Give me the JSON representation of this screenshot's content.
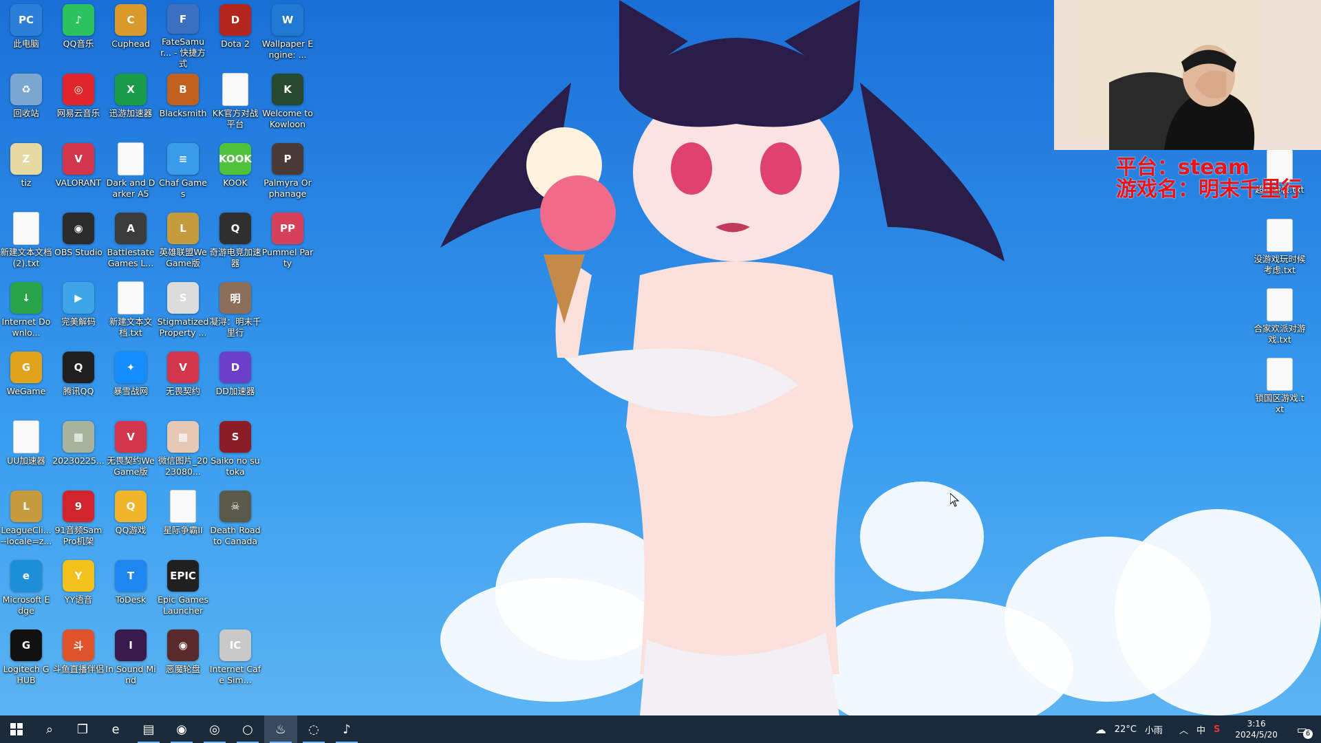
{
  "desktop": {
    "icons": [
      {
        "label": "此电脑",
        "glyph": "PC",
        "bg": "#2b7fd8",
        "doc": false
      },
      {
        "label": "QQ音乐",
        "glyph": "♪",
        "bg": "#2ac35f",
        "doc": false
      },
      {
        "label": "Cuphead",
        "glyph": "C",
        "bg": "#d89a2a",
        "doc": false
      },
      {
        "label": "FateSamur... - 快捷方式",
        "glyph": "F",
        "bg": "#3b6fbf",
        "doc": false
      },
      {
        "label": "Dota 2",
        "glyph": "D",
        "bg": "#b3261e",
        "doc": false
      },
      {
        "label": "Wallpaper Engine: ...",
        "glyph": "W",
        "bg": "#1f78d1",
        "doc": false
      },
      {
        "label": "回收站",
        "glyph": "♻",
        "bg": "#7aa6cf",
        "doc": false
      },
      {
        "label": "网易云音乐",
        "glyph": "◎",
        "bg": "#e0262b",
        "doc": false
      },
      {
        "label": "迅游加速器",
        "glyph": "X",
        "bg": "#1a9b4a",
        "doc": false
      },
      {
        "label": "Blacksmith",
        "glyph": "B",
        "bg": "#c2611f",
        "doc": false
      },
      {
        "label": "KK官方对战平台",
        "glyph": "",
        "bg": "#ffffff",
        "doc": true
      },
      {
        "label": "Welcome to Kowloon",
        "glyph": "K",
        "bg": "#274a2f",
        "doc": false
      },
      {
        "label": "tiz",
        "glyph": "Z",
        "bg": "#e7d9a2",
        "doc": false
      },
      {
        "label": "VALORANT",
        "glyph": "V",
        "bg": "#d1364d",
        "doc": false
      },
      {
        "label": "Dark and Darker A5",
        "glyph": "",
        "bg": "#ffffff",
        "doc": true
      },
      {
        "label": "Chaf Games",
        "glyph": "≡",
        "bg": "#3a9be8",
        "doc": false
      },
      {
        "label": "KOOK",
        "glyph": "KOOK",
        "bg": "#4ec23a",
        "doc": false
      },
      {
        "label": "Palmyra Orphanage",
        "glyph": "P",
        "bg": "#4a3a36",
        "doc": false
      },
      {
        "label": "新建文本文档 (2).txt",
        "glyph": "",
        "bg": "#ffffff",
        "doc": true
      },
      {
        "label": "OBS Studio",
        "glyph": "◉",
        "bg": "#2b2b2b",
        "doc": false
      },
      {
        "label": "Battlestate Games L...",
        "glyph": "A",
        "bg": "#3c3c3c",
        "doc": false
      },
      {
        "label": "英雄联盟WeGame版",
        "glyph": "L",
        "bg": "#c59b3e",
        "doc": false
      },
      {
        "label": "奇游电竞加速器",
        "glyph": "Q",
        "bg": "#2f2f2f",
        "doc": false
      },
      {
        "label": "Pummel Party",
        "glyph": "PP",
        "bg": "#d8405a",
        "doc": false
      },
      {
        "label": "Internet Downlo...",
        "glyph": "↓",
        "bg": "#2aa44a",
        "doc": false
      },
      {
        "label": "完美解码",
        "glyph": "▶",
        "bg": "#3da5e8",
        "doc": false
      },
      {
        "label": "新建文本文档.txt",
        "glyph": "",
        "bg": "#ffffff",
        "doc": true
      },
      {
        "label": "Stigmatized Property ...",
        "glyph": "S",
        "bg": "#dcdcdc",
        "doc": false
      },
      {
        "label": "凝浔：明末千里行",
        "glyph": "明",
        "bg": "#8d6e5a",
        "doc": false
      },
      {
        "label": "",
        "glyph": "",
        "bg": "transparent",
        "doc": false
      },
      {
        "label": "WeGame",
        "glyph": "G",
        "bg": "#e0a21a",
        "doc": false
      },
      {
        "label": "腾讯QQ",
        "glyph": "Q",
        "bg": "#1f1f1f",
        "doc": false
      },
      {
        "label": "暴雪战网",
        "glyph": "✦",
        "bg": "#148eff",
        "doc": false
      },
      {
        "label": "无畏契约",
        "glyph": "V",
        "bg": "#d1364d",
        "doc": false
      },
      {
        "label": "DD加速器",
        "glyph": "D",
        "bg": "#6b3fc7",
        "doc": false
      },
      {
        "label": "",
        "glyph": "",
        "bg": "transparent",
        "doc": false
      },
      {
        "label": "UU加速器",
        "glyph": "",
        "bg": "#ffffff",
        "doc": true
      },
      {
        "label": "20230225...",
        "glyph": "▦",
        "bg": "#a7b39c",
        "doc": false
      },
      {
        "label": "无畏契约WeGame版",
        "glyph": "V",
        "bg": "#d1364d",
        "doc": false
      },
      {
        "label": "微信图片_2023080...",
        "glyph": "▦",
        "bg": "#e6c9b4",
        "doc": false
      },
      {
        "label": "Saiko no sutoka",
        "glyph": "S",
        "bg": "#8a1d28",
        "doc": false
      },
      {
        "label": "",
        "glyph": "",
        "bg": "transparent",
        "doc": false
      },
      {
        "label": "LeagueCli... --locale=z...",
        "glyph": "L",
        "bg": "#c59b3e",
        "doc": false
      },
      {
        "label": "91音频SamPro机架",
        "glyph": "9",
        "bg": "#d1252c",
        "doc": false
      },
      {
        "label": "QQ游戏",
        "glyph": "Q",
        "bg": "#f0b52a",
        "doc": false
      },
      {
        "label": "星际争霸II",
        "glyph": "",
        "bg": "#ffffff",
        "doc": true
      },
      {
        "label": "Death Road to Canada",
        "glyph": "☠",
        "bg": "#5a5a4a",
        "doc": false
      },
      {
        "label": "",
        "glyph": "",
        "bg": "transparent",
        "doc": false
      },
      {
        "label": "Microsoft Edge",
        "glyph": "e",
        "bg": "#1d8fd6",
        "doc": false
      },
      {
        "label": "YY语音",
        "glyph": "Y",
        "bg": "#f2c21b",
        "doc": false
      },
      {
        "label": "ToDesk",
        "glyph": "T",
        "bg": "#1e86f0",
        "doc": false
      },
      {
        "label": "Epic Games Launcher",
        "glyph": "EPIC",
        "bg": "#202020",
        "doc": false
      },
      {
        "label": "",
        "glyph": "",
        "bg": "transparent",
        "doc": false
      },
      {
        "label": "",
        "glyph": "",
        "bg": "transparent",
        "doc": false
      },
      {
        "label": "Logitech G HUB",
        "glyph": "G",
        "bg": "#111111",
        "doc": false
      },
      {
        "label": "斗鱼直播伴侣",
        "glyph": "斗",
        "bg": "#e0522a",
        "doc": false
      },
      {
        "label": "In Sound Mind",
        "glyph": "I",
        "bg": "#3a1a4a",
        "doc": false
      },
      {
        "label": "恶魔轮盘",
        "glyph": "◉",
        "bg": "#5a2a2a",
        "doc": false
      },
      {
        "label": "Internet Cafe Sim...",
        "glyph": "IC",
        "bg": "#c9c9c9",
        "doc": false
      }
    ],
    "right_icons": [
      {
        "label": "超声波表.txt"
      },
      {
        "label": "没游戏玩时候考虑.txt"
      },
      {
        "label": "合家欢派对游戏.txt"
      },
      {
        "label": "锁国区游戏.txt"
      }
    ]
  },
  "overlay": {
    "platform_line": "平台：steam",
    "game_line": "游戏名：明末千里行"
  },
  "taskbar": {
    "start_icon": "windows-start-icon",
    "pinned": [
      {
        "name": "search",
        "glyph": "⌕"
      },
      {
        "name": "task-view",
        "glyph": "❐"
      },
      {
        "name": "edge",
        "glyph": "e"
      },
      {
        "name": "file-explorer",
        "glyph": "▤"
      },
      {
        "name": "chrome",
        "glyph": "◉"
      },
      {
        "name": "obs",
        "glyph": "◎"
      },
      {
        "name": "app-yellow",
        "glyph": "○"
      },
      {
        "name": "steam",
        "glyph": "♨"
      },
      {
        "name": "app-circle",
        "glyph": "◌"
      },
      {
        "name": "qq-music",
        "glyph": "♪"
      }
    ],
    "weather_temp": "22°C",
    "weather_desc": "小雨",
    "ime": "中",
    "time": "3:16",
    "date": "2024/5/20",
    "notification_count": "6"
  }
}
